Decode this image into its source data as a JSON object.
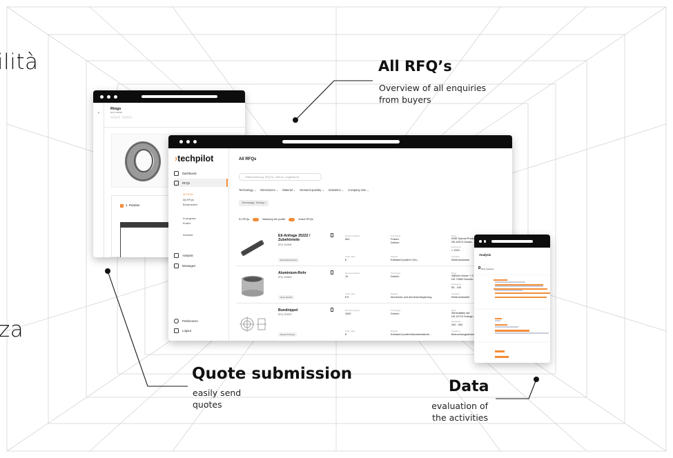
{
  "edge_text": {
    "top": "ilità",
    "bottom": "za"
  },
  "callouts": {
    "all_rfqs": {
      "title": "All RFQ’s",
      "subtitle_line1": "Overview of all enquiries",
      "subtitle_line2": "from buyers"
    },
    "quote": {
      "title": "Quote submission",
      "subtitle_line1": "easily send",
      "subtitle_line2": "quotes"
    },
    "data": {
      "title": "Data",
      "subtitle_line1": "evaluation of",
      "subtitle_line2": "the activities"
    }
  },
  "ring_window": {
    "title": "Rings",
    "subtitle": "RFQ 265806",
    "position_label": "1. Position"
  },
  "main_window": {
    "logo": "techpilot",
    "nav": {
      "dashboard": "Dashboard",
      "rfqs": "RFQs",
      "all_rfqs": "All RFQs",
      "my_rfqs": "My RFQs",
      "bookmarked": "Bookmarked",
      "in_progress": "In progress",
      "ended": "Ended",
      "archived": "Archived",
      "analysis": "Analysis",
      "messages": "Messages",
      "preferences": "Preferences",
      "logout": "Logout"
    },
    "page_title": "All RFQs",
    "search_placeholder": "Teilebezeichnung, RFQ-Nr., Teile-Nr., Angebots-Nr.",
    "filters": [
      "Technology ⌄",
      "Dimensions ⌄",
      "Material ⌄",
      "Demand quantity ⌄",
      "Industries ⌄",
      "Company size ⌄"
    ],
    "active_filter": "Technology: Turning ×",
    "rfq_count": "51 RFQs",
    "toggle_matching": "Matching the profile",
    "toggle_active": "Active RFQs",
    "rows": [
      {
        "title": "Eil-Anfrage 25222 / Zubehörteile",
        "number": "RFQ 264906",
        "tag": "Bestellabwicklung",
        "qty_label": "Demand quantity",
        "qty": "500",
        "price_label": "Order value",
        "price": "€",
        "tech_label": "Technology",
        "tech": "Fräsen\nDrehen",
        "material_label": "Material",
        "material": "Edelstahl (rostfrei V2A...",
        "buyer_label": "Buyer",
        "buyer": "KME Special Produc\nDE-49074 Osnab...",
        "emp_label": "Employees",
        "emp": "> 1000",
        "industry_label": "Industries",
        "industry": "Elektroindustrie"
      },
      {
        "title": "Aluminium-Rohr",
        "number": "RFQ 264803",
        "tag": "Serie ähnlich",
        "qty_label": "Demand quantity",
        "qty": "10",
        "price_label": "Order value",
        "price": "€ €",
        "tech_label": "Technology",
        "tech": "Drehen",
        "material_label": "Material",
        "material": "Aluminium und Aluminiumlegierung",
        "buyer_label": "Buyer",
        "buyer": "Wilhelm Huber + S\nDE-79652 Denzlin...",
        "emp_label": "Employees",
        "emp": "50 - 100",
        "industry_label": "Industries",
        "industry": "Elektroindustrie"
      },
      {
        "title": "Bundnippel",
        "number": "RFQ 264675",
        "tag": "Muster Prototyp",
        "qty_label": "Demand quantity",
        "qty": "1000",
        "price_label": "Order value",
        "price": "€",
        "tech_label": "Technology",
        "tech": "Drehen",
        "material_label": "Material",
        "material": "Edelstahl (rostfrei/säurebestände...",
        "buyer_label": "Buyer",
        "buyer": "Werkstätten der\nDE-42719 Solinge...",
        "emp_label": "Employees",
        "emp": "200 - 500",
        "industry_label": "Industries",
        "industry": "Beleuchtungstechnik"
      }
    ]
  },
  "data_window": {
    "title": "Analysis",
    "tab": "RFQ statistics"
  },
  "colors": {
    "accent": "#f28c38",
    "bar_gray": "#c8cdd8",
    "window_bar": "#0d0d0d"
  }
}
